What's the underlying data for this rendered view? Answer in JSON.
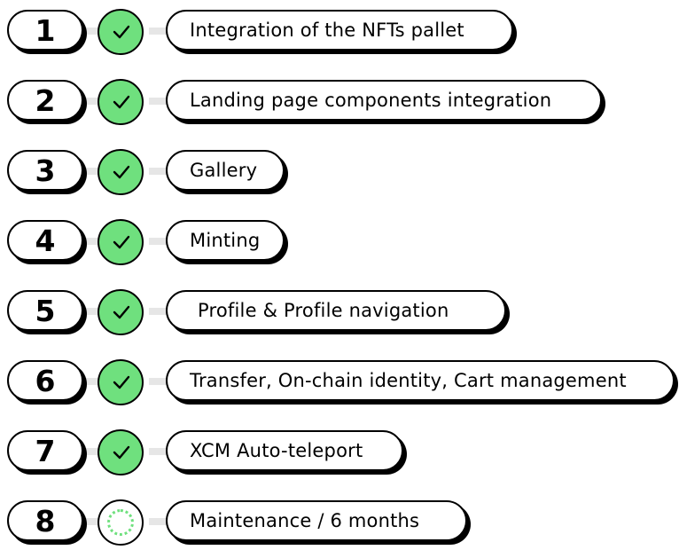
{
  "milestones": [
    {
      "number": "1",
      "label": "Integration of the NFTs pallet",
      "status": "done"
    },
    {
      "number": "2",
      "label": "Landing page components integration",
      "status": "done"
    },
    {
      "number": "3",
      "label": "Gallery",
      "status": "done"
    },
    {
      "number": "4",
      "label": "Minting",
      "status": "done"
    },
    {
      "number": "5",
      "label": "Profile & Profile navigation",
      "status": "done"
    },
    {
      "number": "6",
      "label": "Transfer, On-chain identity, Cart management",
      "status": "done"
    },
    {
      "number": "7",
      "label": "XCM Auto-teleport",
      "status": "done"
    },
    {
      "number": "8",
      "label": "Maintenance / 6 months",
      "status": "pending"
    }
  ],
  "colors": {
    "done": "#6fe07e",
    "outline": "#000000",
    "connector": "#e6e6e6"
  }
}
